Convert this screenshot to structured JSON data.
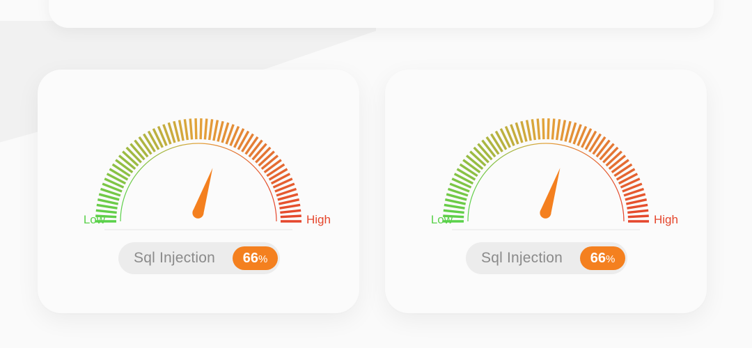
{
  "gauges": [
    {
      "label": "Sql Injection",
      "value": 66,
      "unit": "%",
      "low_label": "Low",
      "high_label": "High",
      "needle_level": 0.6
    },
    {
      "label": "Sql Injection",
      "value": 66,
      "unit": "%",
      "low_label": "Low",
      "high_label": "High",
      "needle_level": 0.6
    }
  ],
  "colors": {
    "low": "#5ad14a",
    "mid": "#e3a23a",
    "high": "#e5462c",
    "needle": "#f4801f",
    "badge": "#f4801f"
  },
  "icons": [
    "gauge-icon",
    "needle-icon"
  ]
}
